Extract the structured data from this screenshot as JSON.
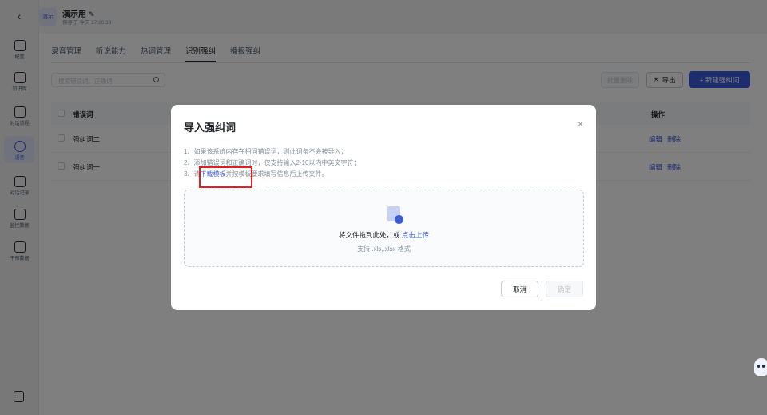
{
  "header": {
    "project_badge": "演示",
    "project_title": "演示用",
    "edit_glyph": "✎",
    "saved_text": "保存于 今天 17:20:39"
  },
  "sidebar": {
    "back_glyph": "‹",
    "items": [
      {
        "label": "配置",
        "icon": "sliders-icon"
      },
      {
        "label": "知识库",
        "icon": "book-icon"
      },
      {
        "label": "对话流程",
        "icon": "flow-icon"
      },
      {
        "label": "语音",
        "icon": "microphone-icon",
        "active": true
      },
      {
        "label": "对话记录",
        "icon": "chat-icon"
      },
      {
        "label": "监控数据",
        "icon": "monitor-icon"
      },
      {
        "label": "干预数据",
        "icon": "intervene-icon"
      }
    ]
  },
  "tabs": [
    {
      "label": "录音管理"
    },
    {
      "label": "听说能力"
    },
    {
      "label": "热词管理"
    },
    {
      "label": "识别强纠",
      "active": true
    },
    {
      "label": "播报强纠"
    }
  ],
  "toolbar": {
    "search_placeholder": "搜索错误词、正确词",
    "batch_delete": "批量删除",
    "export": "导出",
    "new": "+ 新建强纠词"
  },
  "table": {
    "col_wrong": "错误词",
    "col_ops": "操作",
    "rows": [
      {
        "word": "强纠词二",
        "edit": "编辑",
        "delete": "删除"
      },
      {
        "word": "强纠词一",
        "edit": "编辑",
        "delete": "删除"
      }
    ]
  },
  "dialog": {
    "title": "导入强纠词",
    "close": "×",
    "tip1": "1、如果该系统内存在相同错误词，则此词条不会被导入；",
    "tip2": "2、添加错误词和正确词时，仅支持输入2-10以内中英文字符；",
    "tip3_prefix": "3、请",
    "tip3_link": "下载模板",
    "tip3_suffix": "并按模板要求填写信息后上传文件。",
    "upload_text": "将文件拖到此处，或",
    "upload_link": "点击上传",
    "upload_hint": "支持 .xls,.xlsx 格式",
    "cancel": "取消",
    "confirm": "确定"
  },
  "colors": {
    "accent": "#3b5bdb",
    "highlight_box": "#e02020"
  }
}
